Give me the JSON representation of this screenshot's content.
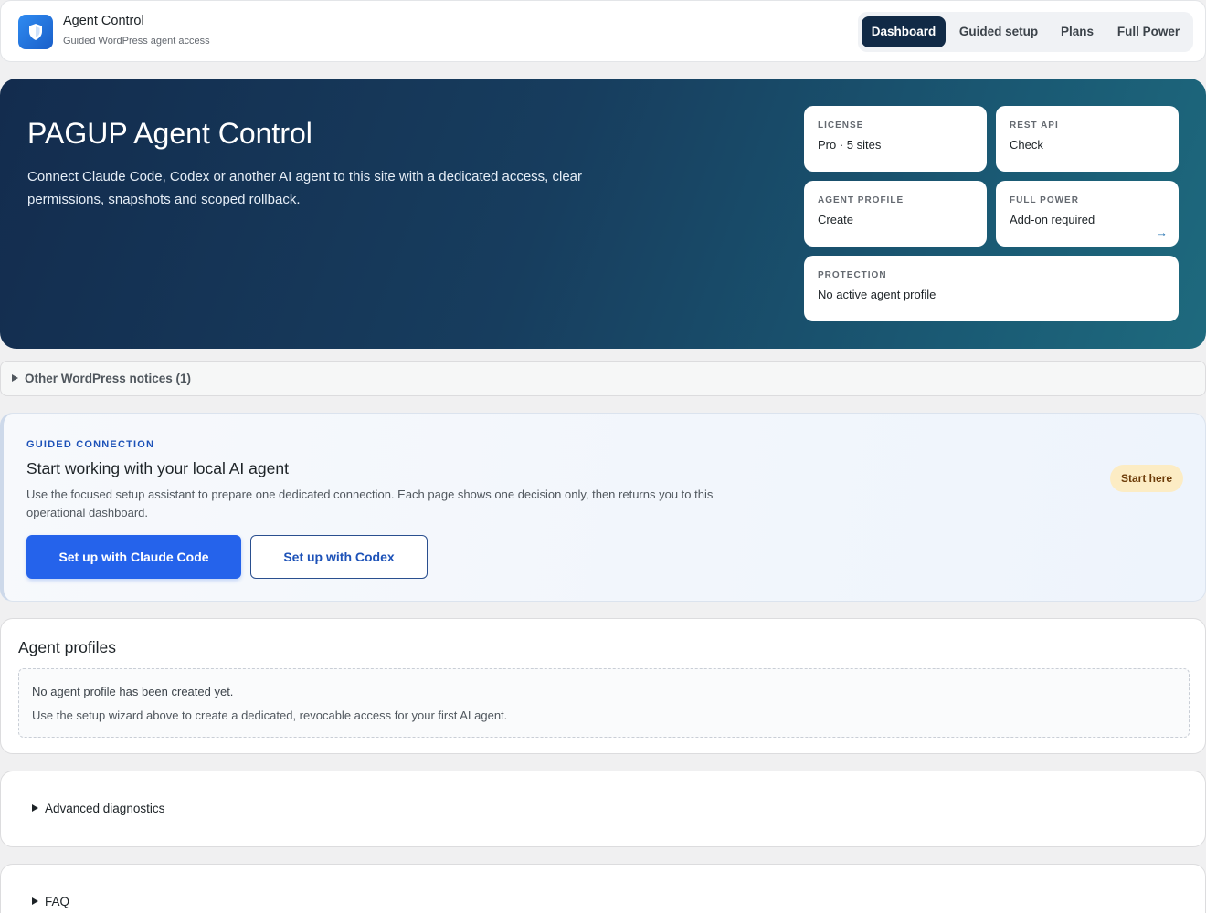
{
  "header": {
    "brand_title": "Agent Control",
    "brand_subtitle": "Guided WordPress agent access",
    "logo_icon": "shield-icon",
    "nav": [
      {
        "label": "Dashboard",
        "active": true
      },
      {
        "label": "Guided setup",
        "active": false
      },
      {
        "label": "Plans",
        "active": false
      },
      {
        "label": "Full Power",
        "active": false
      }
    ]
  },
  "hero": {
    "title": "PAGUP Agent Control",
    "description": "Connect Claude Code, Codex or another AI agent to this site with a dedicated access, clear permissions, snapshots and scoped rollback.",
    "stats": [
      {
        "label": "LICENSE",
        "value": "Pro · 5 sites"
      },
      {
        "label": "REST API",
        "value": "Check"
      },
      {
        "label": "AGENT PROFILE",
        "value": "Create"
      },
      {
        "label": "FULL POWER",
        "value": "Add-on required",
        "arrow": "→"
      },
      {
        "label": "PROTECTION",
        "value": "No active agent profile"
      }
    ]
  },
  "notices": {
    "label": "Other WordPress notices (1)"
  },
  "guided": {
    "eyebrow": "GUIDED CONNECTION",
    "title": "Start working with your local AI agent",
    "description": "Use the focused setup assistant to prepare one dedicated connection. Each page shows one decision only, then returns you to this operational dashboard.",
    "primary_button": "Set up with Claude Code",
    "secondary_button": "Set up with Codex",
    "badge": "Start here"
  },
  "profiles": {
    "title": "Agent profiles",
    "empty_title": "No agent profile has been created yet.",
    "empty_description": "Use the setup wizard above to create a dedicated, revocable access for your first AI agent."
  },
  "diagnostics": {
    "label": "Advanced diagnostics"
  },
  "faq": {
    "label": "FAQ"
  },
  "colors": {
    "accent": "#2563eb",
    "nav_active": "#112a46",
    "hero_start": "#132c4e",
    "hero_end": "#1e6a7e",
    "badge_bg": "#fcecc4"
  }
}
